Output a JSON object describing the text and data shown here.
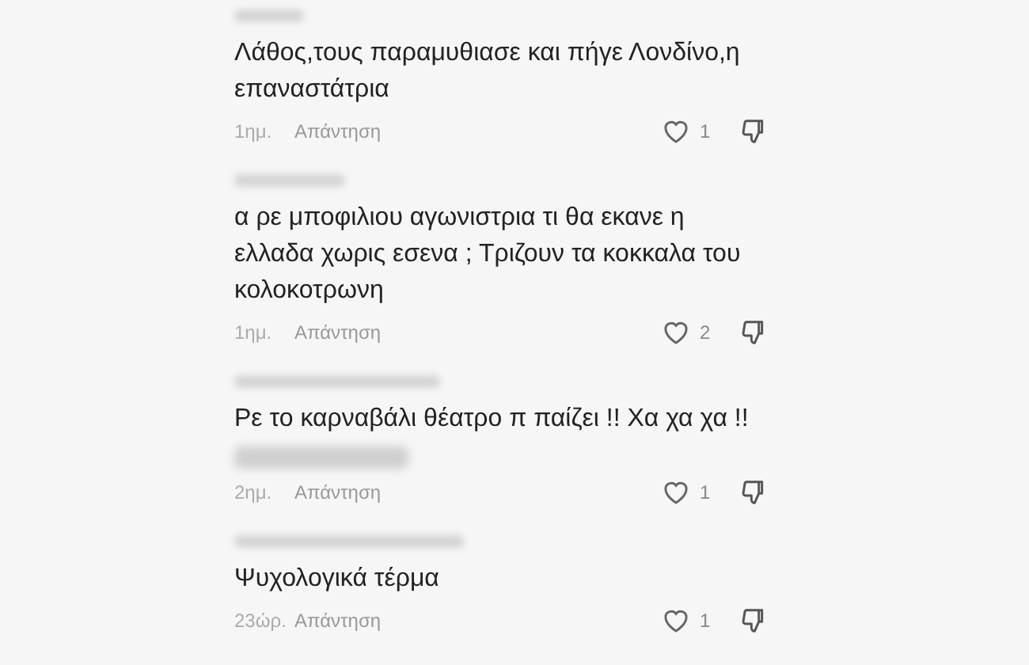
{
  "comments": [
    {
      "text": "Λάθος,τους παραμυθιασε και πήγε Λονδίνο,η επαναστάτρια",
      "hidden_line": false,
      "time": "1ημ.",
      "reply": "Απάντηση",
      "likes": "1"
    },
    {
      "text": "α ρε μποφιλιου αγωνιστρια τι θα εκανε η ελλαδα χωρις εσενα ; Τριζουν τα κοκκαλα του κολοκοτρωνη",
      "hidden_line": false,
      "time": "1ημ.",
      "reply": "Απάντηση",
      "likes": "2"
    },
    {
      "text": "Ρε το καρναβάλι θέατρο π παίζει !! Χα χα χα !!",
      "hidden_line": true,
      "time": "2ημ.",
      "reply": "Απάντηση",
      "likes": "1"
    },
    {
      "text": "Ψυχολογικά τέρμα",
      "hidden_line": false,
      "time": "23ώρ.",
      "reply": "Απάντηση",
      "likes": "1"
    }
  ]
}
